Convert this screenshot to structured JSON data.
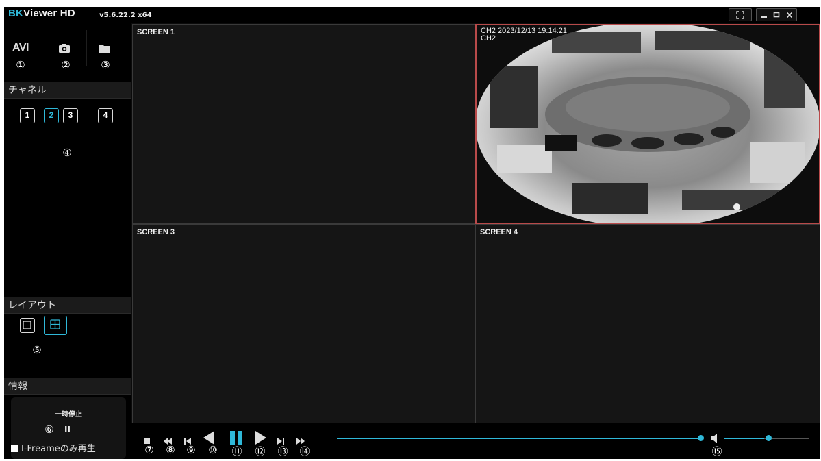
{
  "app": {
    "brand_prefix": "BK",
    "brand_rest": "Viewer HD",
    "version": "v5.6.22.2 x64"
  },
  "toolbar": {
    "avi_label": "AVI",
    "annotations": [
      "①",
      "②",
      "③"
    ]
  },
  "channel": {
    "header": "チャネル",
    "buttons": [
      "1",
      "2",
      "3",
      "4"
    ],
    "active": "2",
    "annotation": "④"
  },
  "layout": {
    "header": "レイアウト",
    "annotation": "⑤",
    "active": "quad"
  },
  "info": {
    "header": "情報",
    "status": "一時停止",
    "annotation": "⑥",
    "pause_glyph": "II",
    "iframe_label": "I-Freameのみ再生"
  },
  "screens": {
    "s1": "SCREEN 1",
    "s2_overlay_line1": "CH2  2023/12/13 19:14:21",
    "s2_overlay_line2": "CH2",
    "s3": "SCREEN 3",
    "s4": "SCREEN 4"
  },
  "controls": {
    "annotations": [
      "⑦",
      "⑧",
      "⑨",
      "⑩",
      "⑪",
      "⑫",
      "⑬",
      "⑭",
      "⑮"
    ],
    "seek_progress": 1.0,
    "volume_level": 0.5
  },
  "colors": {
    "accent": "#2fb8d8",
    "active_screen_border": "#b84a4a",
    "background": "#000000"
  }
}
